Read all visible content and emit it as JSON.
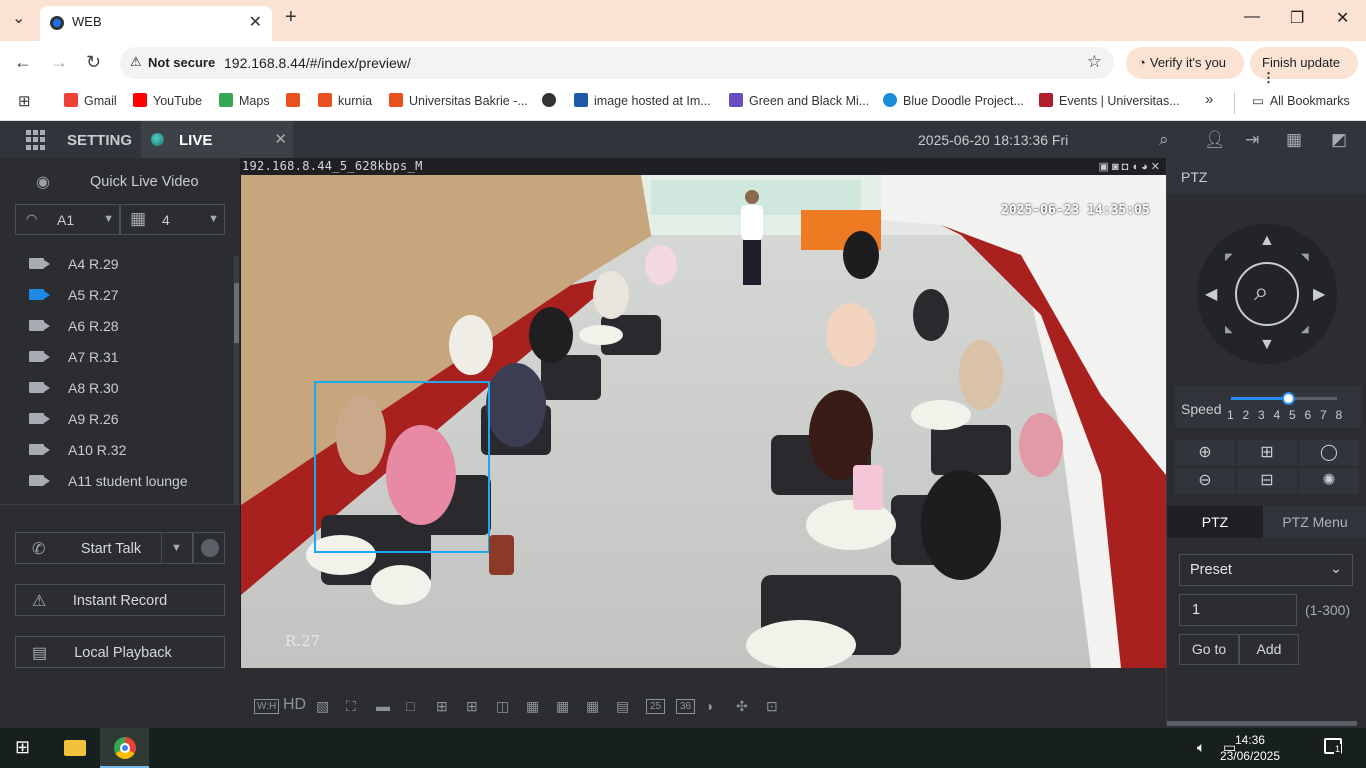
{
  "browser": {
    "tab_title": "WEB",
    "security_label": "Not secure",
    "url": "192.168.8.44/#/index/preview/",
    "verify_label": "Verify it's you",
    "update_label": "Finish update",
    "bookmarks": [
      {
        "label": "Gmail",
        "color": "#ea4335"
      },
      {
        "label": "YouTube",
        "color": "#ff0000"
      },
      {
        "label": "Maps",
        "color": "#34a853"
      },
      {
        "label": "",
        "color": "#e8501f"
      },
      {
        "label": "kurnia",
        "color": "#e8501f"
      },
      {
        "label": "Universitas Bakrie -...",
        "color": "#e8501f"
      },
      {
        "label": "",
        "color": "#333333"
      },
      {
        "label": "image hosted at Im...",
        "color": "#1e5aa8"
      },
      {
        "label": "Green and Black Mi...",
        "color": "#6a4cc2"
      },
      {
        "label": "Blue Doodle Project...",
        "color": "#1a8cd8"
      },
      {
        "label": "Events | Universitas...",
        "color": "#b01e2a"
      }
    ],
    "all_bookmarks": "All Bookmarks"
  },
  "app": {
    "setting_label": "SETTING",
    "live_label": "LIVE",
    "datetime": "2025-06-20 18:13:36 Fri"
  },
  "left": {
    "quick_live": "Quick Live Video",
    "select_a": "A1",
    "select_layout": "4",
    "devices": [
      {
        "label": "A4 R.29",
        "active": false
      },
      {
        "label": "A5 R.27",
        "active": true
      },
      {
        "label": "A6 R.28",
        "active": false
      },
      {
        "label": "A7 R.31",
        "active": false
      },
      {
        "label": "A8 R.30",
        "active": false
      },
      {
        "label": "A9 R.26",
        "active": false
      },
      {
        "label": "A10 R.32",
        "active": false
      },
      {
        "label": "A11 student lounge",
        "active": false
      }
    ],
    "start_talk": "Start Talk",
    "instant_record": "Instant Record",
    "local_playback": "Local Playback"
  },
  "video": {
    "stream_label": "192.168.8.44_5_628kbps_M",
    "osd_time": "2025-06-23 14:35:05",
    "osd_channel": "R.27",
    "toolbar": [
      "W:H",
      "HD",
      "25",
      "36"
    ]
  },
  "ptz": {
    "header": "PTZ",
    "speed_label": "Speed",
    "speed_values": [
      "1",
      "2",
      "3",
      "4",
      "5",
      "6",
      "7",
      "8"
    ],
    "speed_level": 5,
    "tab_ptz": "PTZ",
    "tab_menu": "PTZ Menu",
    "preset_label": "Preset",
    "preset_value": "1",
    "preset_range": "(1-300)",
    "goto": "Go to",
    "add": "Add"
  },
  "taskbar": {
    "time": "14:36",
    "date": "23/06/2025",
    "notif_count": "1"
  }
}
